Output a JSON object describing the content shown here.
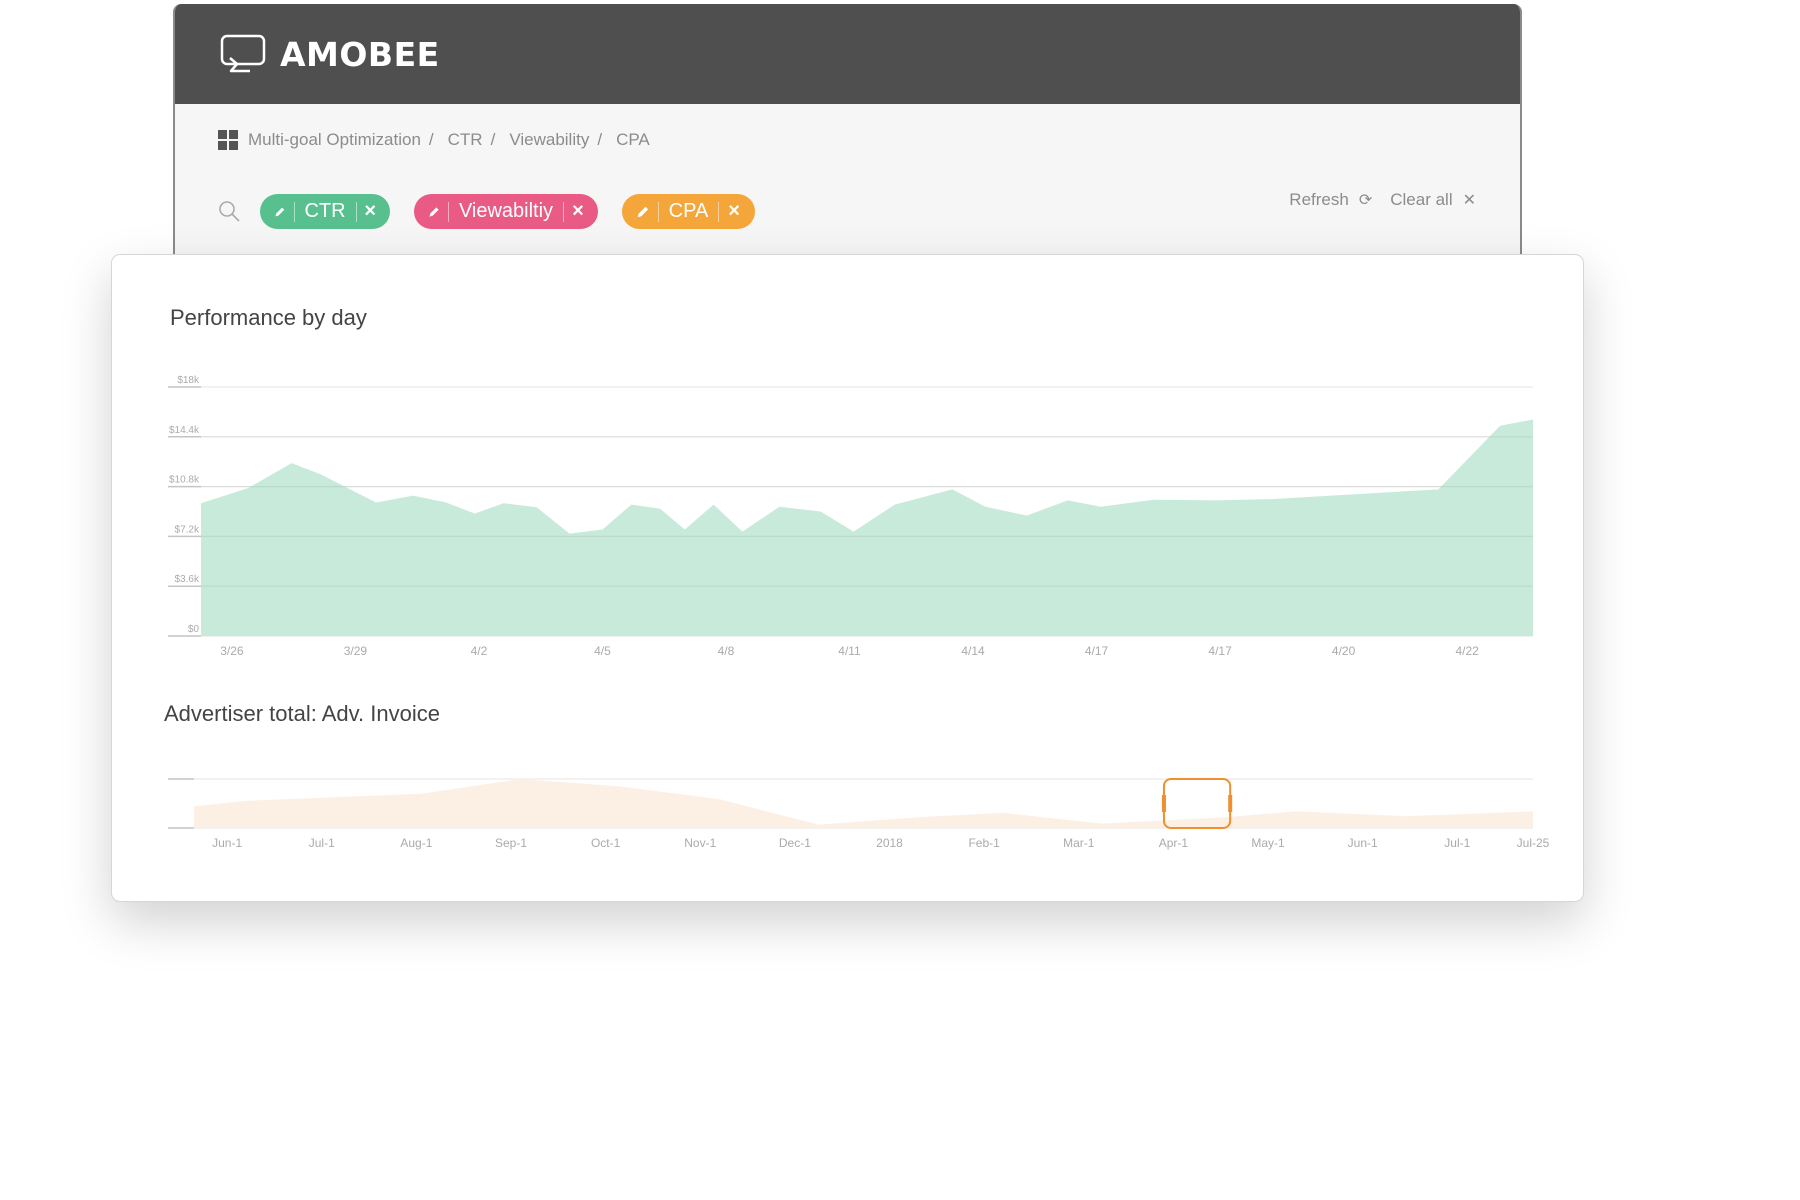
{
  "brand": {
    "name": "AMOBEE",
    "logo_icon": "monitor-icon"
  },
  "breadcrumb": {
    "icon": "dashboard-icon",
    "items": [
      "Multi-goal Optimization",
      "CTR",
      "Viewability",
      "CPA"
    ],
    "separator": "/"
  },
  "filters": {
    "search_icon": "search-icon",
    "pills": [
      {
        "label": "CTR",
        "color": "#58c08e",
        "edit_icon": "pencil-icon",
        "remove_icon": "close-icon"
      },
      {
        "label": "Viewabiltiy",
        "color": "#e95a84",
        "edit_icon": "pencil-icon",
        "remove_icon": "close-icon"
      },
      {
        "label": "CPA",
        "color": "#f5a63a",
        "edit_icon": "pencil-icon",
        "remove_icon": "close-icon"
      }
    ]
  },
  "actions": {
    "refresh_label": "Refresh",
    "refresh_icon": "refresh-icon",
    "clear_label": "Clear all",
    "clear_icon": "close-icon"
  },
  "chart_data": [
    {
      "type": "area",
      "title": "Performance by day",
      "xlabel": "",
      "ylabel": "",
      "x_unit": "days since 3/26",
      "color": "#c2e8d7",
      "ylim": [
        0,
        18000
      ],
      "yticks": [
        {
          "value": 0,
          "label": "$0"
        },
        {
          "value": 3600,
          "label": "$3.6k"
        },
        {
          "value": 7200,
          "label": "$7.2k"
        },
        {
          "value": 10800,
          "label": "$10.8k"
        },
        {
          "value": 14400,
          "label": "$14.4k"
        },
        {
          "value": 18000,
          "label": "$18k"
        }
      ],
      "xlim": [
        -0.75,
        31.6
      ],
      "xticks": [
        {
          "x": 0,
          "label": "3/26"
        },
        {
          "x": 3,
          "label": "3/29"
        },
        {
          "x": 6,
          "label": "4/2"
        },
        {
          "x": 9,
          "label": "4/5"
        },
        {
          "x": 12,
          "label": "4/8"
        },
        {
          "x": 15,
          "label": "4/11"
        },
        {
          "x": 18,
          "label": "4/14"
        },
        {
          "x": 21,
          "label": "4/17"
        },
        {
          "x": 24,
          "label": "4/17"
        },
        {
          "x": 27,
          "label": "4/20"
        },
        {
          "x": 30,
          "label": "4/22"
        }
      ],
      "grid": true,
      "points": [
        {
          "x": -0.75,
          "y": 9600
        },
        {
          "x": 0.4,
          "y": 10700
        },
        {
          "x": 1.45,
          "y": 12500
        },
        {
          "x": 2.15,
          "y": 11700
        },
        {
          "x": 3.5,
          "y": 9650
        },
        {
          "x": 4.4,
          "y": 10150
        },
        {
          "x": 5.2,
          "y": 9650
        },
        {
          "x": 5.9,
          "y": 8850
        },
        {
          "x": 6.6,
          "y": 9600
        },
        {
          "x": 7.4,
          "y": 9300
        },
        {
          "x": 8.2,
          "y": 7400
        },
        {
          "x": 9.0,
          "y": 7700
        },
        {
          "x": 9.7,
          "y": 9500
        },
        {
          "x": 10.4,
          "y": 9200
        },
        {
          "x": 11.0,
          "y": 7700
        },
        {
          "x": 11.7,
          "y": 9500
        },
        {
          "x": 12.4,
          "y": 7550
        },
        {
          "x": 13.3,
          "y": 9350
        },
        {
          "x": 14.3,
          "y": 9000
        },
        {
          "x": 15.1,
          "y": 7550
        },
        {
          "x": 16.1,
          "y": 9500
        },
        {
          "x": 17.5,
          "y": 10600
        },
        {
          "x": 18.3,
          "y": 9350
        },
        {
          "x": 19.3,
          "y": 8700
        },
        {
          "x": 20.3,
          "y": 9800
        },
        {
          "x": 21.1,
          "y": 9350
        },
        {
          "x": 22.4,
          "y": 9850
        },
        {
          "x": 23.9,
          "y": 9800
        },
        {
          "x": 25.3,
          "y": 9900
        },
        {
          "x": 29.3,
          "y": 10600
        },
        {
          "x": 30.8,
          "y": 15200
        },
        {
          "x": 31.6,
          "y": 15650
        }
      ]
    },
    {
      "type": "area",
      "title": "Advertiser total: Adv. Invoice",
      "xlabel": "",
      "ylabel": "",
      "x_unit": "months since Jun-1",
      "color": "#fcf0e5",
      "ylim": [
        0,
        1
      ],
      "y_unit": "relative (unlabeled axis)",
      "xlim": [
        -0.35,
        13.8
      ],
      "xticks": [
        {
          "x": 0,
          "label": "Jun-1"
        },
        {
          "x": 1,
          "label": "Jul-1"
        },
        {
          "x": 2,
          "label": "Aug-1"
        },
        {
          "x": 3,
          "label": "Sep-1"
        },
        {
          "x": 4,
          "label": "Oct-1"
        },
        {
          "x": 5,
          "label": "Nov-1"
        },
        {
          "x": 6,
          "label": "Dec-1"
        },
        {
          "x": 7,
          "label": "2018"
        },
        {
          "x": 8,
          "label": "Feb-1"
        },
        {
          "x": 9,
          "label": "Mar-1"
        },
        {
          "x": 10,
          "label": "Apr-1"
        },
        {
          "x": 11,
          "label": "May-1"
        },
        {
          "x": 12,
          "label": "Jun-1"
        },
        {
          "x": 13,
          "label": "Jul-1"
        },
        {
          "x": 13.8,
          "label": "Jul-25"
        }
      ],
      "grid": true,
      "points": [
        {
          "x": -0.35,
          "y": 0.44
        },
        {
          "x": 0.17,
          "y": 0.55
        },
        {
          "x": 2.05,
          "y": 0.7
        },
        {
          "x": 3.1,
          "y": 1.0
        },
        {
          "x": 4.15,
          "y": 0.85
        },
        {
          "x": 5.2,
          "y": 0.59
        },
        {
          "x": 6.25,
          "y": 0.07
        },
        {
          "x": 7.3,
          "y": 0.22
        },
        {
          "x": 8.2,
          "y": 0.31
        },
        {
          "x": 9.25,
          "y": 0.09
        },
        {
          "x": 10.55,
          "y": 0.22
        },
        {
          "x": 11.3,
          "y": 0.34
        },
        {
          "x": 12.45,
          "y": 0.24
        },
        {
          "x": 13.8,
          "y": 0.34
        }
      ],
      "selection": {
        "x_start": 9.9,
        "x_end": 10.6,
        "color": "#ef8f2e"
      }
    }
  ]
}
